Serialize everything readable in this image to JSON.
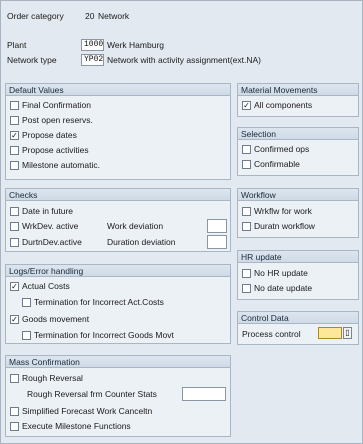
{
  "header": {
    "order_category_label": "Order category",
    "order_category_code": "20",
    "order_category_name": "Network",
    "plant_label": "Plant",
    "plant_value": "1000",
    "plant_name": "Werk Hamburg",
    "network_type_label": "Network type",
    "network_type_value": "YP02",
    "network_type_name": "Network with activity assignment(ext.NA)"
  },
  "default_values": {
    "title": "Default Values",
    "items": [
      {
        "label": "Final Confirmation",
        "checked": false
      },
      {
        "label": "Post open reservs.",
        "checked": false
      },
      {
        "label": "Propose dates",
        "checked": true
      },
      {
        "label": "Propose activities",
        "checked": false
      },
      {
        "label": "Milestone automatic.",
        "checked": false
      }
    ]
  },
  "material_movements": {
    "title": "Material Movements",
    "items": [
      {
        "label": "All components",
        "checked": true
      }
    ]
  },
  "selection": {
    "title": "Selection",
    "items": [
      {
        "label": "Confirmed ops",
        "checked": false
      },
      {
        "label": "Confirmable",
        "checked": false
      }
    ]
  },
  "checks": {
    "title": "Checks",
    "items": [
      {
        "label": "Date in future",
        "checked": false
      },
      {
        "label": "WrkDev. active",
        "checked": false
      },
      {
        "label": "DurtnDev.active",
        "checked": false
      }
    ],
    "work_deviation_label": "Work deviation",
    "duration_deviation_label": "Duration deviation"
  },
  "workflow": {
    "title": "Workflow",
    "items": [
      {
        "label": "Wrkflw for work",
        "checked": false
      },
      {
        "label": "Duratn workflow",
        "checked": false
      }
    ]
  },
  "log_error": {
    "title": "Logs/Error handling",
    "items": [
      {
        "label": "Actual Costs",
        "checked": true
      },
      {
        "label": "Termination for Incorrect Act.Costs",
        "checked": false
      },
      {
        "label": "Goods movement",
        "checked": true
      },
      {
        "label": "Termination for Incorrect Goods Movt",
        "checked": false
      }
    ]
  },
  "hr_update": {
    "title": "HR update",
    "items": [
      {
        "label": "No HR update",
        "checked": false
      },
      {
        "label": "No date update",
        "checked": false
      }
    ]
  },
  "control_data": {
    "title": "Control Data",
    "process_control_label": "Process control"
  },
  "mass_confirmation": {
    "title": "Mass Confirmation",
    "items": [
      {
        "label": "Rough Reversal",
        "checked": false
      },
      {
        "label": "Simplified Forecast Work Canceltn",
        "checked": false
      },
      {
        "label": "Execute Milestone Functions",
        "checked": false
      }
    ],
    "rough_reversal_stats_label": "Rough Reversal frm Counter Stats"
  },
  "colors": {
    "background": "#e2e9f1",
    "group_header": "#d6e0eb",
    "highlight_field": "#ffe79a"
  }
}
